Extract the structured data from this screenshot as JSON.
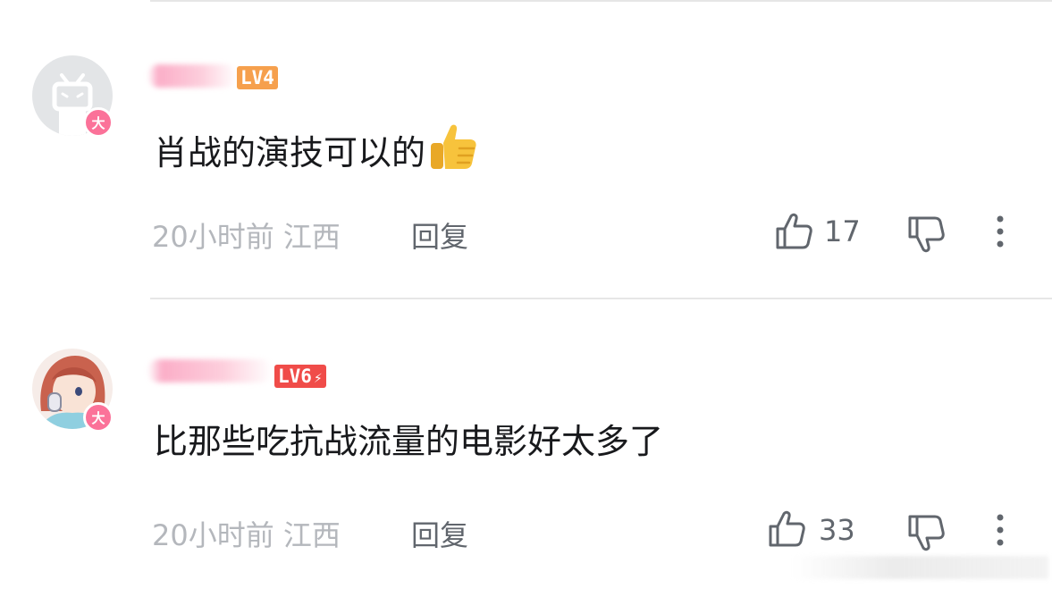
{
  "comments": [
    {
      "level": "LV4",
      "level_color": "#f6a04d",
      "vip_badge": "大",
      "text": "肖战的演技可以的",
      "emoji": "thumbs-up-emoji",
      "time": "20小时前",
      "location": "江西",
      "reply_label": "回复",
      "likes": "17"
    },
    {
      "level": "LV6",
      "level_color": "#f04c49",
      "level_flash": "⚡",
      "vip_badge": "大",
      "text": "比那些吃抗战流量的电影好太多了",
      "time": "20小时前",
      "location": "江西",
      "reply_label": "回复",
      "likes": "33"
    }
  ],
  "colors": {
    "vip_badge": "#fb7299",
    "meta_text": "#b4b7bc",
    "action_text": "#61666d",
    "body_text": "#18191c"
  },
  "icons": [
    "like-icon",
    "dislike-icon",
    "more-vertical-icon"
  ]
}
